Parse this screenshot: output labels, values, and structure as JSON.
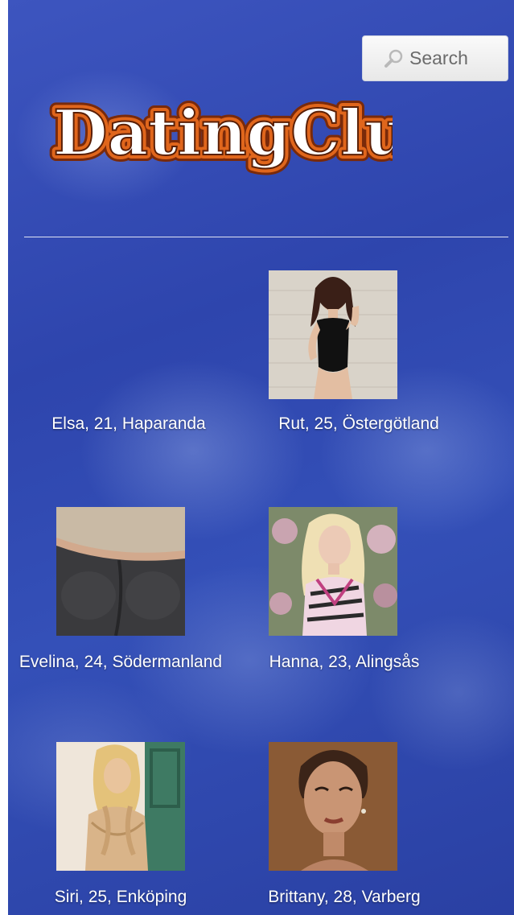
{
  "header": {
    "search_label": "Search",
    "logo_text": "DatingClub"
  },
  "profiles": [
    {
      "label": "Elsa, 21, Haparanda"
    },
    {
      "label": "Rut, 25, Östergötland"
    },
    {
      "label": "Evelina, 24, Södermanland"
    },
    {
      "label": "Hanna, 23, Alingsås"
    },
    {
      "label": "Siri, 25, Enköping"
    },
    {
      "label": "Brittany, 28, Varberg"
    }
  ],
  "colors": {
    "background": "#2e43a8",
    "logo_fill": "#ffffff",
    "logo_outline": "#e0661c"
  }
}
